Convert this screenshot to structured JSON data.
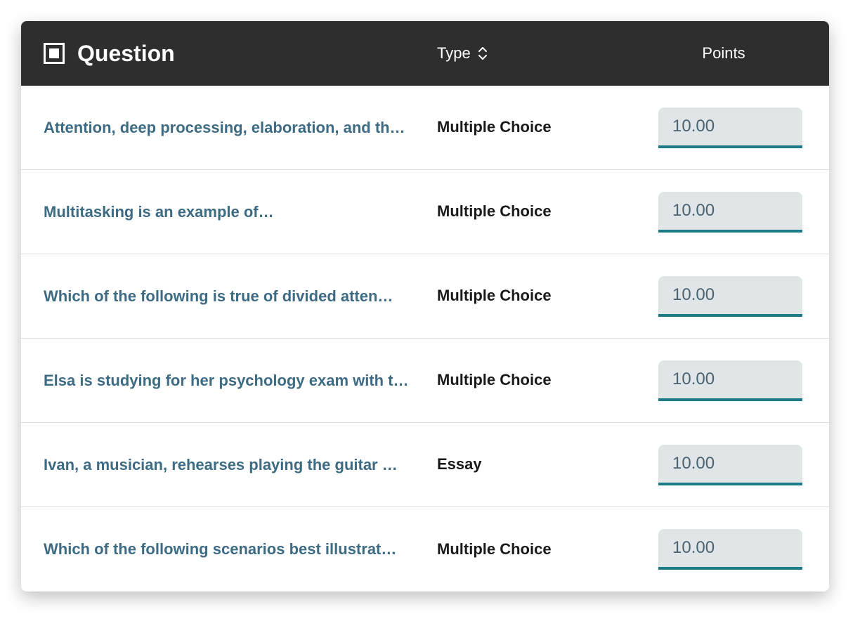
{
  "header": {
    "question_label": "Question",
    "type_label": "Type",
    "points_label": "Points"
  },
  "rows": [
    {
      "question": "Attention, deep processing, elaboration, and th…",
      "type": "Multiple Choice",
      "points": "10.00"
    },
    {
      "question": "Multitasking is an example of…",
      "type": "Multiple Choice",
      "points": "10.00"
    },
    {
      "question": "Which of the following is true of divided atten…",
      "type": "Multiple Choice",
      "points": "10.00"
    },
    {
      "question": "Elsa is studying for her psychology exam with t…",
      "type": "Multiple Choice",
      "points": "10.00"
    },
    {
      "question": "Ivan, a musician, rehearses playing the guitar …",
      "type": "Essay",
      "points": "10.00"
    },
    {
      "question": "Which of the following scenarios best illustrat…",
      "type": "Multiple Choice",
      "points": "10.00"
    }
  ]
}
